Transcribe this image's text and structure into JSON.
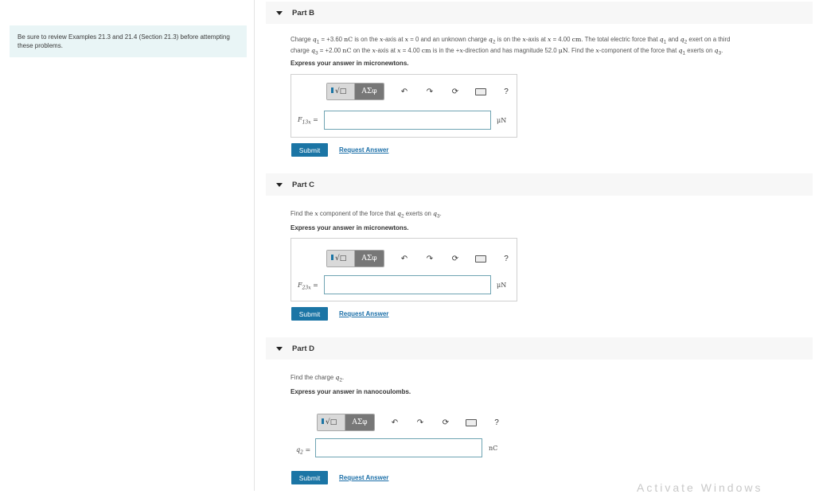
{
  "sidebar": {
    "note": "Be sure to review Examples 21.3 and 21.4 (Section 21.3) before attempting these problems."
  },
  "toolbar": {
    "templates_icon": "templates-icon",
    "greek_label": "ΑΣφ",
    "help_label": "?"
  },
  "partB": {
    "title": "Part B",
    "problem": {
      "a": "Charge ",
      "q1": "q",
      "q1sub": "1",
      "b": " = +3.60 ",
      "u1": "nC",
      "c": " is on the ",
      "xa": "x",
      "d": "-axis at ",
      "xb": "x",
      "e": " = 0 and an unknown charge ",
      "q2": "q",
      "q2sub": "2",
      "f": " is on the ",
      "xc": "x",
      "g": "-axis at ",
      "xd": "x",
      "h": " = 4.00 ",
      "u2": "cm",
      "i": ". The total electric force that ",
      "q1b": "q",
      "q1bsub": "1",
      "j": " and ",
      "q2b": "q",
      "q2bsub": "2",
      "k": " exert on a third",
      "l": "charge ",
      "q3": "q",
      "q3sub": "3",
      "m": " = +2.00 ",
      "u3": "nC",
      "n": " on the ",
      "xe": "x",
      "o": "-axis at ",
      "xf": "x",
      "p": " = 4.00 ",
      "u4": "cm",
      "q": " is in the +",
      "xg": "x",
      "r": "-direction and has magnitude 52.0 ",
      "u5": "μN",
      "s": ". Find the ",
      "xh": "x",
      "t": "-component of the force that ",
      "q1c": "q",
      "q1csub": "1",
      "v": " exerts on ",
      "q3b": "q",
      "q3bsub": "3",
      "w": "."
    },
    "instruction": "Express your answer in micronewtons.",
    "var": "F",
    "var_sub": "13x",
    "eq": " =",
    "unit": "μN",
    "submit": "Submit",
    "request": "Request Answer"
  },
  "partC": {
    "title": "Part C",
    "problem": {
      "a": "Find the ",
      "x": "x",
      "b": " component of the force that ",
      "q": "q",
      "qsub": "2",
      "c": " exerts on ",
      "q3": "q",
      "q3sub": "3",
      "d": "."
    },
    "instruction": "Express your answer in micronewtons.",
    "var": "F",
    "var_sub": "23x",
    "eq": " =",
    "unit": "μN",
    "submit": "Submit",
    "request": "Request Answer"
  },
  "partD": {
    "title": "Part D",
    "problem": {
      "a": "Find the charge ",
      "q": "q",
      "qsub": "2",
      "d": "."
    },
    "instruction": "Express your answer in nanocoulombs.",
    "var": "q",
    "var_sub": "2",
    "eq": " =",
    "unit": "nC",
    "submit": "Submit",
    "request": "Request Answer"
  },
  "watermark": "Activate Windows"
}
